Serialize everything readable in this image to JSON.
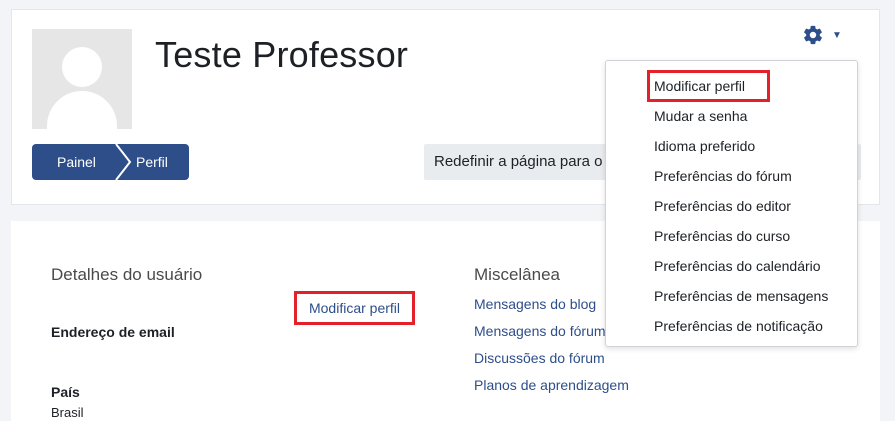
{
  "header": {
    "title": "Teste Professor",
    "reset_text": "Redefinir a página para o padrão"
  },
  "breadcrumb": {
    "items": [
      {
        "label": "Painel"
      },
      {
        "label": "Perfil"
      }
    ]
  },
  "settings_menu": {
    "items": [
      {
        "label": "Modificar perfil"
      },
      {
        "label": "Mudar a senha"
      },
      {
        "label": "Idioma preferido"
      },
      {
        "label": "Preferências do fórum"
      },
      {
        "label": "Preferências do editor"
      },
      {
        "label": "Preferências do curso"
      },
      {
        "label": "Preferências do calendário"
      },
      {
        "label": "Preferências de mensagens"
      },
      {
        "label": "Preferências de notificação"
      }
    ]
  },
  "user_details": {
    "title": "Detalhes do usuário",
    "edit_link": "Modificar perfil",
    "email_label": "Endereço de email",
    "country_label": "País",
    "country_value": "Brasil"
  },
  "misc": {
    "title": "Miscelânea",
    "links": [
      {
        "label": "Mensagens do blog"
      },
      {
        "label": "Mensagens do fórum"
      },
      {
        "label": "Discussões do fórum"
      },
      {
        "label": "Planos de aprendizagem"
      }
    ]
  },
  "colors": {
    "brand": "#2e4e8a",
    "highlight": "#e4202a"
  }
}
